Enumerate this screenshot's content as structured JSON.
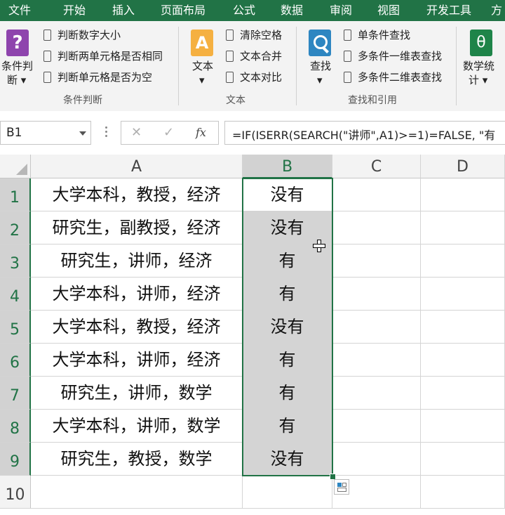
{
  "menu": {
    "items": [
      "文件",
      "开始",
      "插入",
      "页面布局",
      "公式",
      "数据",
      "审阅",
      "视图",
      "开发工具",
      "方"
    ]
  },
  "ribbon": {
    "cond_big": {
      "label_1": "条件判",
      "label_2": "断 ▾"
    },
    "cond_items": [
      "判断数字大小",
      "判断两单元格是否相同",
      "判断单元格是否为空"
    ],
    "cond_group": "条件判断",
    "text_big": {
      "label": "文本",
      "arrow": "▾"
    },
    "text_items": [
      "清除空格",
      "文本合并",
      "文本对比"
    ],
    "text_group": "文本",
    "find_big": {
      "label": "查找",
      "arrow": "▾"
    },
    "find_items": [
      "单条件查找",
      "多条件一维表查找",
      "多条件二维表查找"
    ],
    "find_group": "查找和引用",
    "stat_big": {
      "label_1": "数学统",
      "label_2": "计 ▾"
    },
    "icon_letter_text": "A",
    "icon_letter_stat": "θ",
    "icon_letter_cond": "?"
  },
  "formula_bar": {
    "name_box": "B1",
    "cancel": "✕",
    "enter": "✓",
    "fx": "fx",
    "formula": "=IF(ISERR(SEARCH(\"讲师\",A1)>=1)=FALSE, \"有"
  },
  "sheet": {
    "columns": [
      "A",
      "B",
      "C",
      "D"
    ],
    "rows": [
      "1",
      "2",
      "3",
      "4",
      "5",
      "6",
      "7",
      "8",
      "9",
      "10"
    ],
    "col_a": [
      "大学本科，教授，经济",
      "研究生，副教授，经济",
      "研究生，讲师，经济",
      "大学本科，讲师，经济",
      "大学本科，教授，经济",
      "大学本科，讲师，经济",
      "研究生，讲师，数学",
      "大学本科，讲师，数学",
      "研究生，教授，数学"
    ],
    "col_b": [
      "没有",
      "没有",
      "有",
      "有",
      "没有",
      "有",
      "有",
      "有",
      "没有"
    ]
  },
  "colors": {
    "accent": "#217346",
    "selection": "#d4d4d4"
  }
}
